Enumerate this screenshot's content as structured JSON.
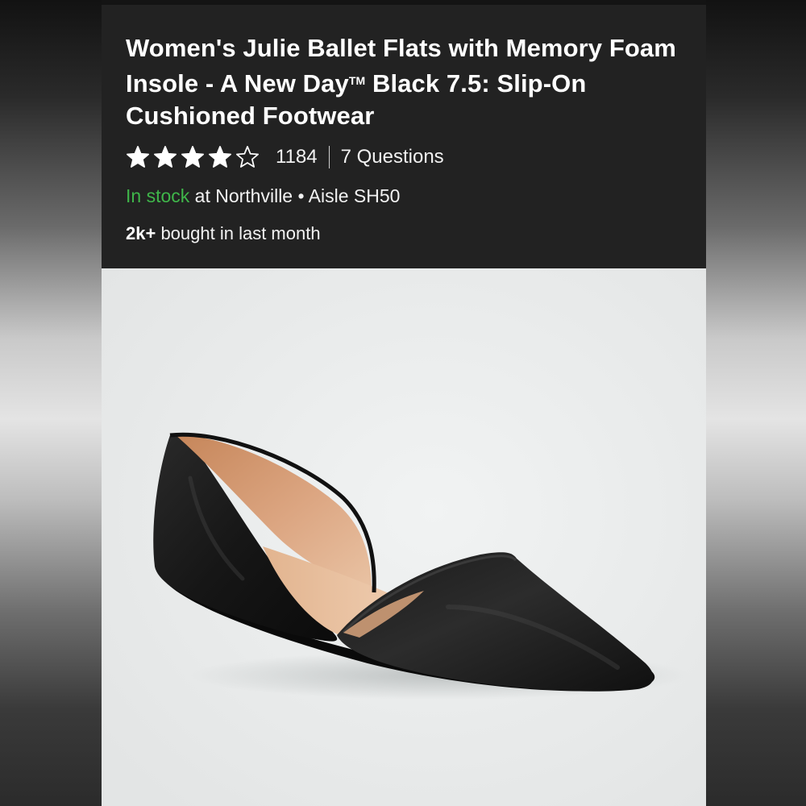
{
  "product": {
    "title_main": "Women's Julie Ballet Flats with Memory Foam Insole - A New Day",
    "trademark": "TM",
    "title_rest": " Black 7.5: Slip-On Cushioned Footwear",
    "rating_stars": 4,
    "rating_max": 5,
    "review_count": "1184",
    "questions": "7 Questions",
    "stock_status": "In stock",
    "stock_location": " at Northville • Aisle SH50",
    "bought_count": "2k+",
    "bought_text": " bought in last month"
  },
  "colors": {
    "info_background": "#222222",
    "in_stock_green": "#3fb64a",
    "star_fill": "#ffffff"
  },
  "image": {
    "subject": "black pointed-toe d'Orsay ballet flat with tan lining"
  }
}
